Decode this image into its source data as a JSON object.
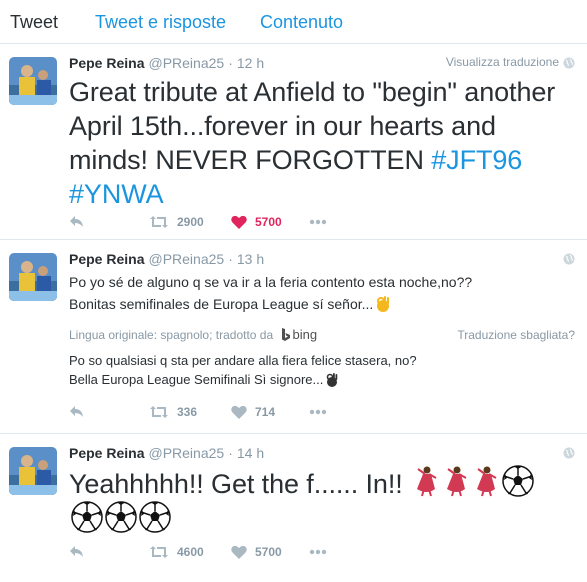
{
  "tabs": [
    "Tweet",
    "Tweet e risposte",
    "Contenuto"
  ],
  "colors": {
    "accent": "#1b95e0",
    "muted": "#8899a6",
    "like": "#e0245e",
    "text": "#292f33"
  },
  "tweets": [
    {
      "name": "Pepe Reina",
      "handle": "@PReina25",
      "dot": "·",
      "time": "12 h",
      "translate_link": "Visualizza traduzione",
      "text_main": "Great tribute at Anfield to \"begin\" another April 15th...forever in our hearts and minds! NEVER FORGOTTEN ",
      "hashtag1": "#JFT96",
      "hashtag2": "#YNWA",
      "retweets": "2900",
      "likes": "5700",
      "liked": true
    },
    {
      "name": "Pepe Reina",
      "handle": "@PReina25",
      "dot": "·",
      "time": "13 h",
      "line1": "Po yo sé de alguno q se va ir a la feria contento esta noche,no??",
      "line2": "Bonitas semifinales de Europa League sí señor...",
      "translation_note": "Lingua originale: spagnolo; tradotto da",
      "bing_label": "bing",
      "wrong_translation": "Traduzione sbagliata?",
      "trans_line1": "Po so qualsiasi q sta per andare alla fiera felice stasera, no?",
      "trans_line2": "Bella Europa League Semifinali Sì signore...",
      "retweets": "336",
      "likes": "714"
    },
    {
      "name": "Pepe Reina",
      "handle": "@PReina25",
      "dot": "·",
      "time": "14 h",
      "text_main": "Yeahhhhh!! Get the f...... In!!",
      "retweets": "4600",
      "likes": "5700"
    }
  ]
}
